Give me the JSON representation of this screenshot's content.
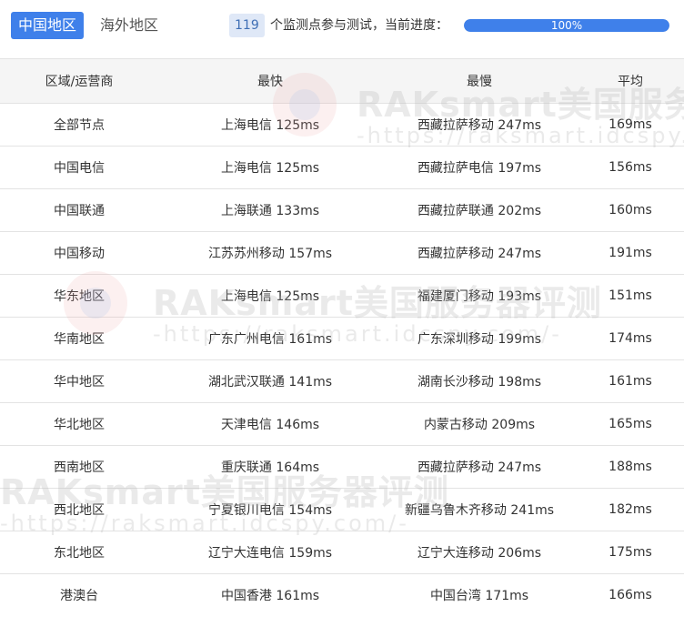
{
  "tabs": {
    "active": "中国地区",
    "inactive": "海外地区"
  },
  "progress": {
    "count": "119",
    "caption": "个监测点参与测试，当前进度：",
    "percent_label": "100%",
    "fraction": 1.0
  },
  "table": {
    "headers": [
      "区域/运营商",
      "最快",
      "最慢",
      "平均"
    ],
    "rows": [
      {
        "region": "全部节点",
        "fastest": "上海电信 125ms",
        "slowest": "西藏拉萨移动 247ms",
        "average": "169ms"
      },
      {
        "region": "中国电信",
        "fastest": "上海电信 125ms",
        "slowest": "西藏拉萨电信 197ms",
        "average": "156ms"
      },
      {
        "region": "中国联通",
        "fastest": "上海联通 133ms",
        "slowest": "西藏拉萨联通 202ms",
        "average": "160ms"
      },
      {
        "region": "中国移动",
        "fastest": "江苏苏州移动 157ms",
        "slowest": "西藏拉萨移动 247ms",
        "average": "191ms"
      },
      {
        "region": "华东地区",
        "fastest": "上海电信 125ms",
        "slowest": "福建厦门移动 193ms",
        "average": "151ms"
      },
      {
        "region": "华南地区",
        "fastest": "广东广州电信 161ms",
        "slowest": "广东深圳移动 199ms",
        "average": "174ms"
      },
      {
        "region": "华中地区",
        "fastest": "湖北武汉联通 141ms",
        "slowest": "湖南长沙移动 198ms",
        "average": "161ms"
      },
      {
        "region": "华北地区",
        "fastest": "天津电信 146ms",
        "slowest": "内蒙古移动 209ms",
        "average": "165ms"
      },
      {
        "region": "西南地区",
        "fastest": "重庆联通 164ms",
        "slowest": "西藏拉萨移动 247ms",
        "average": "188ms"
      },
      {
        "region": "西北地区",
        "fastest": "宁夏银川电信 154ms",
        "slowest": "新疆乌鲁木齐移动 241ms",
        "average": "182ms"
      },
      {
        "region": "东北地区",
        "fastest": "辽宁大连电信 159ms",
        "slowest": "辽宁大连移动 206ms",
        "average": "175ms"
      },
      {
        "region": "港澳台",
        "fastest": "中国香港 161ms",
        "slowest": "中国台湾 171ms",
        "average": "166ms"
      }
    ]
  },
  "watermark": {
    "brand": "RAKsmart美国服务器评测",
    "url": "-https://raksmart.idcspy.com/-"
  },
  "colors": {
    "accent": "#3f80ea",
    "badge_bg": "#dfe8f7",
    "header_bg": "#f5f5f5",
    "border": "#e3e3e3"
  }
}
